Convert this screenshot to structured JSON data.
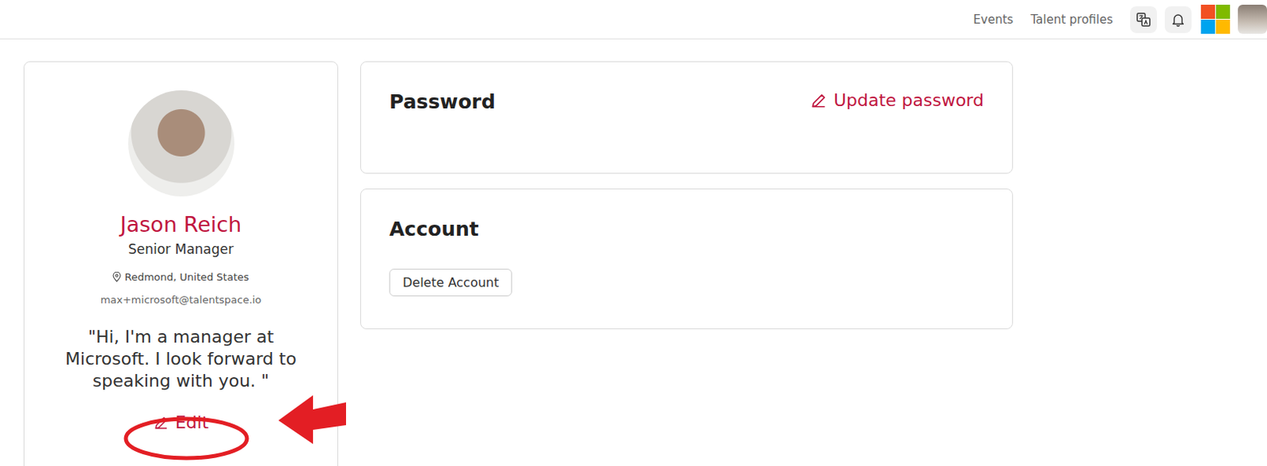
{
  "nav": {
    "links": [
      "Events",
      "Talent profiles"
    ]
  },
  "profile": {
    "name": "Jason Reich",
    "title": "Senior Manager",
    "location": "Redmond, United States",
    "email": "max+microsoft@talentspace.io",
    "quote": "\"Hi, I'm a manager at Microsoft. I look forward to speaking with you. \"",
    "edit": "Edit"
  },
  "password": {
    "title": "Password",
    "action": "Update password"
  },
  "account": {
    "title": "Account",
    "button": "Delete Account"
  }
}
